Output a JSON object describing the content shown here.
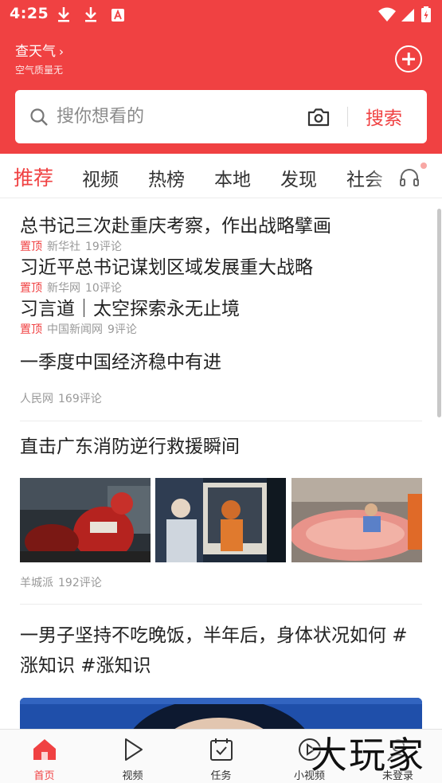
{
  "status_bar": {
    "time": "4:25",
    "left_icons": [
      "download-icon",
      "download-icon",
      "app-store-icon"
    ],
    "right_icons": [
      "wifi-icon",
      "signal-icon",
      "battery-icon"
    ]
  },
  "header": {
    "weather_label": "查天气",
    "weather_arrow": "›",
    "air_quality": "空气质量无",
    "add_icon": "plus-circle-icon"
  },
  "search": {
    "placeholder": "搜你想看的",
    "button_label": "搜索"
  },
  "tabs": [
    {
      "label": "推荐",
      "active": true
    },
    {
      "label": "视频",
      "active": false
    },
    {
      "label": "热榜",
      "active": false
    },
    {
      "label": "本地",
      "active": false
    },
    {
      "label": "发现",
      "active": false
    },
    {
      "label": "社会",
      "active": false
    }
  ],
  "pinned": [
    {
      "title": "总书记三次赴重庆考察，作出战略擘画",
      "badge": "置顶",
      "source": "新华社",
      "comments": "19评论"
    },
    {
      "title": "习近平总书记谋划区域发展重大战略",
      "badge": "置顶",
      "source": "新华网",
      "comments": "10评论"
    },
    {
      "title": "习言道｜太空探索永无止境",
      "badge": "置顶",
      "source": "中国新闻网",
      "comments": "9评论"
    }
  ],
  "articles": [
    {
      "title": "一季度中国经济稳中有进",
      "source": "人民网",
      "comments": "169评论"
    },
    {
      "title": "直击广东消防逆行救援瞬间",
      "source": "羊城派",
      "comments": "192评论"
    },
    {
      "title": "一男子坚持不吃晚饭，半年后，身体状况如何 #涨知识 #涨知识"
    }
  ],
  "bottom_nav": [
    {
      "label": "首页",
      "icon": "home-icon",
      "active": true
    },
    {
      "label": "视频",
      "icon": "play-icon",
      "active": false
    },
    {
      "label": "任务",
      "icon": "task-icon",
      "active": false
    },
    {
      "label": "小视频",
      "icon": "short-video-icon",
      "active": false
    },
    {
      "label": "未登录",
      "icon": "user-icon",
      "active": false
    }
  ],
  "watermark": "大玩家",
  "colors": {
    "brand_red": "#f04142",
    "text_primary": "#222222",
    "text_meta": "#999999"
  }
}
